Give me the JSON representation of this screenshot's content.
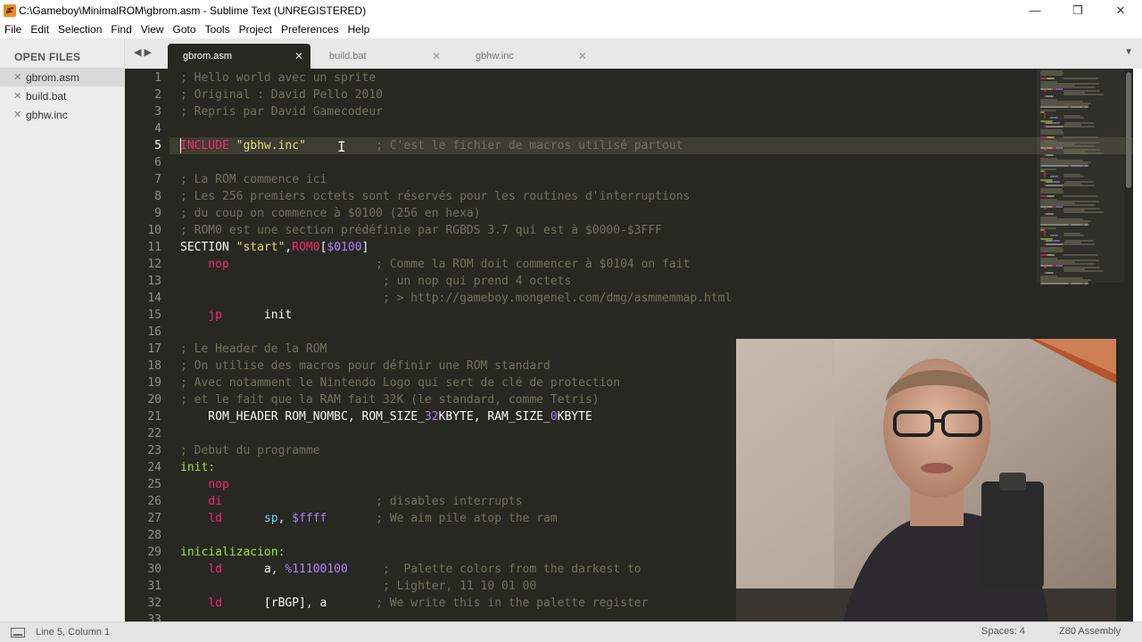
{
  "window": {
    "title": "C:\\Gameboy\\MinimalROM\\gbrom.asm - Sublime Text (UNREGISTERED)",
    "icons": {
      "app": "sublime-text-icon",
      "minimize": "minimize-icon",
      "maximize": "restore-icon",
      "close": "close-icon"
    }
  },
  "menu": [
    "File",
    "Edit",
    "Selection",
    "Find",
    "View",
    "Goto",
    "Tools",
    "Project",
    "Preferences",
    "Help"
  ],
  "sidebar": {
    "header": "OPEN FILES",
    "files": [
      {
        "name": "gbrom.asm",
        "active": true
      },
      {
        "name": "build.bat",
        "active": false
      },
      {
        "name": "gbhw.inc",
        "active": false
      }
    ]
  },
  "tabs": [
    {
      "label": "gbrom.asm",
      "active": true
    },
    {
      "label": "build.bat",
      "active": false
    },
    {
      "label": "gbhw.inc",
      "active": false
    }
  ],
  "editor": {
    "current_line": 5,
    "lines": [
      {
        "n": "1",
        "spans": [
          {
            "t": "; Hello world avec un sprite",
            "c": "cm"
          }
        ]
      },
      {
        "n": "2",
        "spans": [
          {
            "t": "; Original : David Pello 2010",
            "c": "cm"
          }
        ]
      },
      {
        "n": "3",
        "spans": [
          {
            "t": "; Repris par David Gamecodeur",
            "c": "cm"
          }
        ]
      },
      {
        "n": "4",
        "spans": []
      },
      {
        "n": "5",
        "spans": [
          {
            "t": "INCLUDE ",
            "c": "kw"
          },
          {
            "t": "\"gbhw.inc\"",
            "c": "st"
          },
          {
            "t": "          ",
            "c": "tx"
          },
          {
            "t": "; C'est le fichier de macros utilisé partout",
            "c": "cm"
          }
        ]
      },
      {
        "n": "6",
        "spans": []
      },
      {
        "n": "7",
        "spans": [
          {
            "t": "; La ROM commence ici",
            "c": "cm"
          }
        ]
      },
      {
        "n": "8",
        "spans": [
          {
            "t": "; Les 256 premiers octets sont réservés pour les routines d'interruptions",
            "c": "cm"
          }
        ]
      },
      {
        "n": "9",
        "spans": [
          {
            "t": "; du coup on commence à $0100 (256 en hexa)",
            "c": "cm"
          }
        ]
      },
      {
        "n": "10",
        "spans": [
          {
            "t": "; ROM0 est une section prédéfinie par RGBDS 3.7 qui est à $0000-$3FFF",
            "c": "cm"
          }
        ]
      },
      {
        "n": "11",
        "spans": [
          {
            "t": "SECTION ",
            "c": "tx"
          },
          {
            "t": "\"start\"",
            "c": "st"
          },
          {
            "t": ",",
            "c": "tx"
          },
          {
            "t": "ROM0",
            "c": "kw"
          },
          {
            "t": "[",
            "c": "tx"
          },
          {
            "t": "$0100",
            "c": "nm"
          },
          {
            "t": "]",
            "c": "tx"
          }
        ]
      },
      {
        "n": "12",
        "spans": [
          {
            "t": "    ",
            "c": "tx"
          },
          {
            "t": "nop",
            "c": "kw"
          },
          {
            "t": "                     ",
            "c": "tx"
          },
          {
            "t": "; Comme la ROM doit commencer à $0104 on fait",
            "c": "cm"
          }
        ]
      },
      {
        "n": "13",
        "spans": [
          {
            "t": "                             ",
            "c": "tx"
          },
          {
            "t": "; un nop qui prend 4 octets",
            "c": "cm"
          }
        ]
      },
      {
        "n": "14",
        "spans": [
          {
            "t": "                             ",
            "c": "tx"
          },
          {
            "t": "; > http://gameboy.mongenel.com/dmg/asmmemmap.html",
            "c": "cm"
          }
        ]
      },
      {
        "n": "15",
        "spans": [
          {
            "t": "    ",
            "c": "tx"
          },
          {
            "t": "jp",
            "c": "kw"
          },
          {
            "t": "      init",
            "c": "tx"
          }
        ]
      },
      {
        "n": "16",
        "spans": []
      },
      {
        "n": "17",
        "spans": [
          {
            "t": "; Le Header de la ROM",
            "c": "cm"
          }
        ]
      },
      {
        "n": "18",
        "spans": [
          {
            "t": "; On utilise des macros pour définir une ROM standard",
            "c": "cm"
          }
        ]
      },
      {
        "n": "19",
        "spans": [
          {
            "t": "; Avec notamment le Nintendo Logo qui sert de clé de protection",
            "c": "cm"
          }
        ]
      },
      {
        "n": "20",
        "spans": [
          {
            "t": "; et le fait que la RAM fait 32K (le standard, comme Tetris)",
            "c": "cm"
          }
        ]
      },
      {
        "n": "21",
        "spans": [
          {
            "t": "    ROM_HEADER ROM_NOMBC, ROM_SIZE_",
            "c": "tx"
          },
          {
            "t": "32",
            "c": "nm"
          },
          {
            "t": "KBYTE, RAM_SIZE_",
            "c": "tx"
          },
          {
            "t": "0",
            "c": "nm"
          },
          {
            "t": "KBYTE",
            "c": "tx"
          }
        ]
      },
      {
        "n": "22",
        "spans": []
      },
      {
        "n": "23",
        "spans": [
          {
            "t": "; Debut du programme",
            "c": "cm"
          }
        ]
      },
      {
        "n": "24",
        "spans": [
          {
            "t": "init:",
            "c": "lb"
          }
        ]
      },
      {
        "n": "25",
        "spans": [
          {
            "t": "    ",
            "c": "tx"
          },
          {
            "t": "nop",
            "c": "kw"
          }
        ]
      },
      {
        "n": "26",
        "spans": [
          {
            "t": "    ",
            "c": "tx"
          },
          {
            "t": "di",
            "c": "kw"
          },
          {
            "t": "                      ",
            "c": "tx"
          },
          {
            "t": "; disables interrupts",
            "c": "cm"
          }
        ]
      },
      {
        "n": "27",
        "spans": [
          {
            "t": "    ",
            "c": "tx"
          },
          {
            "t": "ld",
            "c": "kw"
          },
          {
            "t": "      ",
            "c": "tx"
          },
          {
            "t": "sp",
            "c": "fn"
          },
          {
            "t": ", ",
            "c": "tx"
          },
          {
            "t": "$ffff",
            "c": "nm"
          },
          {
            "t": "       ",
            "c": "tx"
          },
          {
            "t": "; We aim pile atop the ram",
            "c": "cm"
          }
        ]
      },
      {
        "n": "28",
        "spans": []
      },
      {
        "n": "29",
        "spans": [
          {
            "t": "inicializacion:",
            "c": "lb"
          }
        ]
      },
      {
        "n": "30",
        "spans": [
          {
            "t": "    ",
            "c": "tx"
          },
          {
            "t": "ld",
            "c": "kw"
          },
          {
            "t": "      a, ",
            "c": "tx"
          },
          {
            "t": "%11100100",
            "c": "nm"
          },
          {
            "t": "     ",
            "c": "tx"
          },
          {
            "t": ";  Palette colors from the darkest to",
            "c": "cm"
          }
        ]
      },
      {
        "n": "31",
        "spans": [
          {
            "t": "                             ",
            "c": "tx"
          },
          {
            "t": "; Lighter, 11 10 01 00",
            "c": "cm"
          }
        ]
      },
      {
        "n": "32",
        "spans": [
          {
            "t": "    ",
            "c": "tx"
          },
          {
            "t": "ld",
            "c": "kw"
          },
          {
            "t": "      [rBGP], a       ",
            "c": "tx"
          },
          {
            "t": "; We write this in the palette register",
            "c": "cm"
          }
        ]
      },
      {
        "n": "33",
        "spans": []
      }
    ]
  },
  "statusbar": {
    "position": "Line 5, Column 1",
    "indentation": "Spaces: 4",
    "syntax": "Z80 Assembly",
    "icons": {
      "panel": "panel-toggle-icon"
    }
  },
  "webcam": {
    "icon": "webcam-video-overlay"
  }
}
